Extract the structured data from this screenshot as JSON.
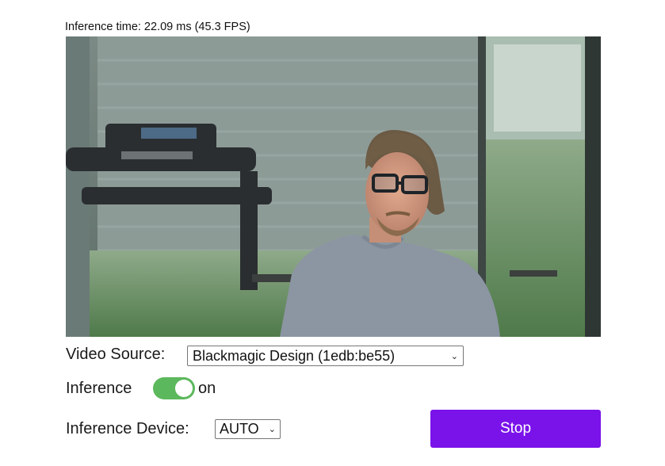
{
  "inference_time_text": "Inference time: 22.09 ms (45.3 FPS)",
  "video_source": {
    "label": "Video Source:",
    "selected": "Blackmagic Design (1edb:be55)"
  },
  "inference": {
    "label": "Inference",
    "toggle_on": true,
    "toggle_state_text": "on",
    "toggle_color": "#5cb85c"
  },
  "inference_device": {
    "label": "Inference Device:",
    "selected": "AUTO"
  },
  "stop_button": {
    "label": "Stop",
    "color": "#7a12ea"
  },
  "icons": {
    "dropdown": "chevron-down-icon"
  }
}
